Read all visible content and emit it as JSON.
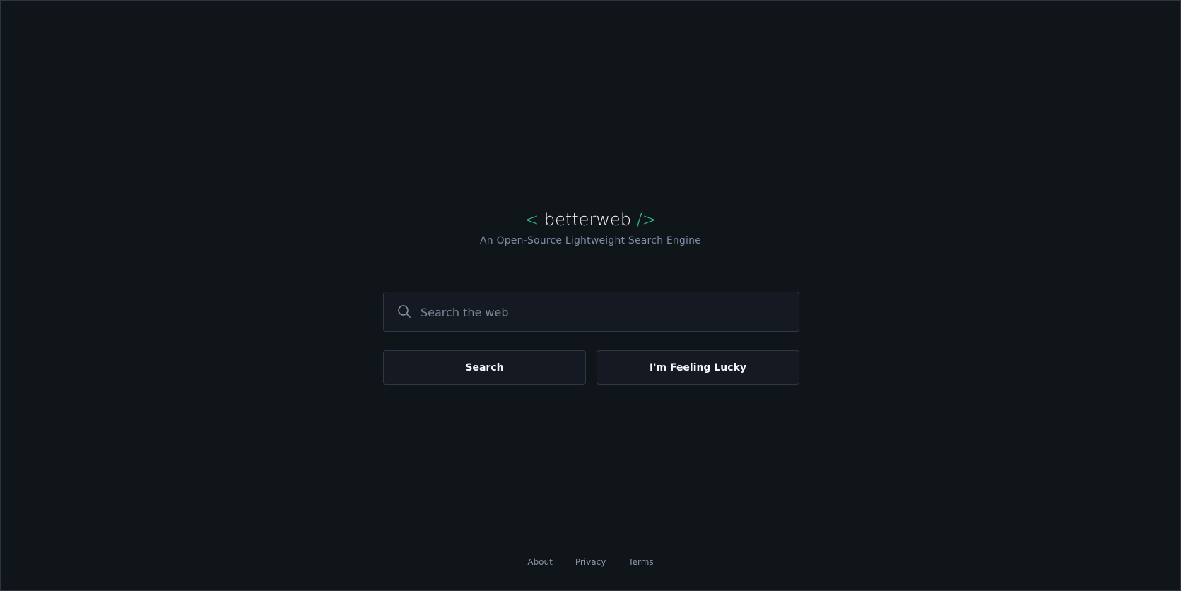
{
  "logo": {
    "open_bracket": "<",
    "name": "betterweb",
    "close_bracket": "/>"
  },
  "tagline": "An Open-Source Lightweight Search Engine",
  "search": {
    "placeholder": "Search the web",
    "value": ""
  },
  "buttons": {
    "search_label": "Search",
    "lucky_label": "I'm Feeling Lucky"
  },
  "footer": {
    "links": [
      "About",
      "Privacy",
      "Terms"
    ]
  },
  "colors": {
    "background": "#10151a",
    "accent": "#34c59a",
    "panel": "#151a22",
    "border": "#2f3644",
    "muted_text": "#7f8ca6"
  },
  "icons": {
    "search": "search-icon"
  }
}
